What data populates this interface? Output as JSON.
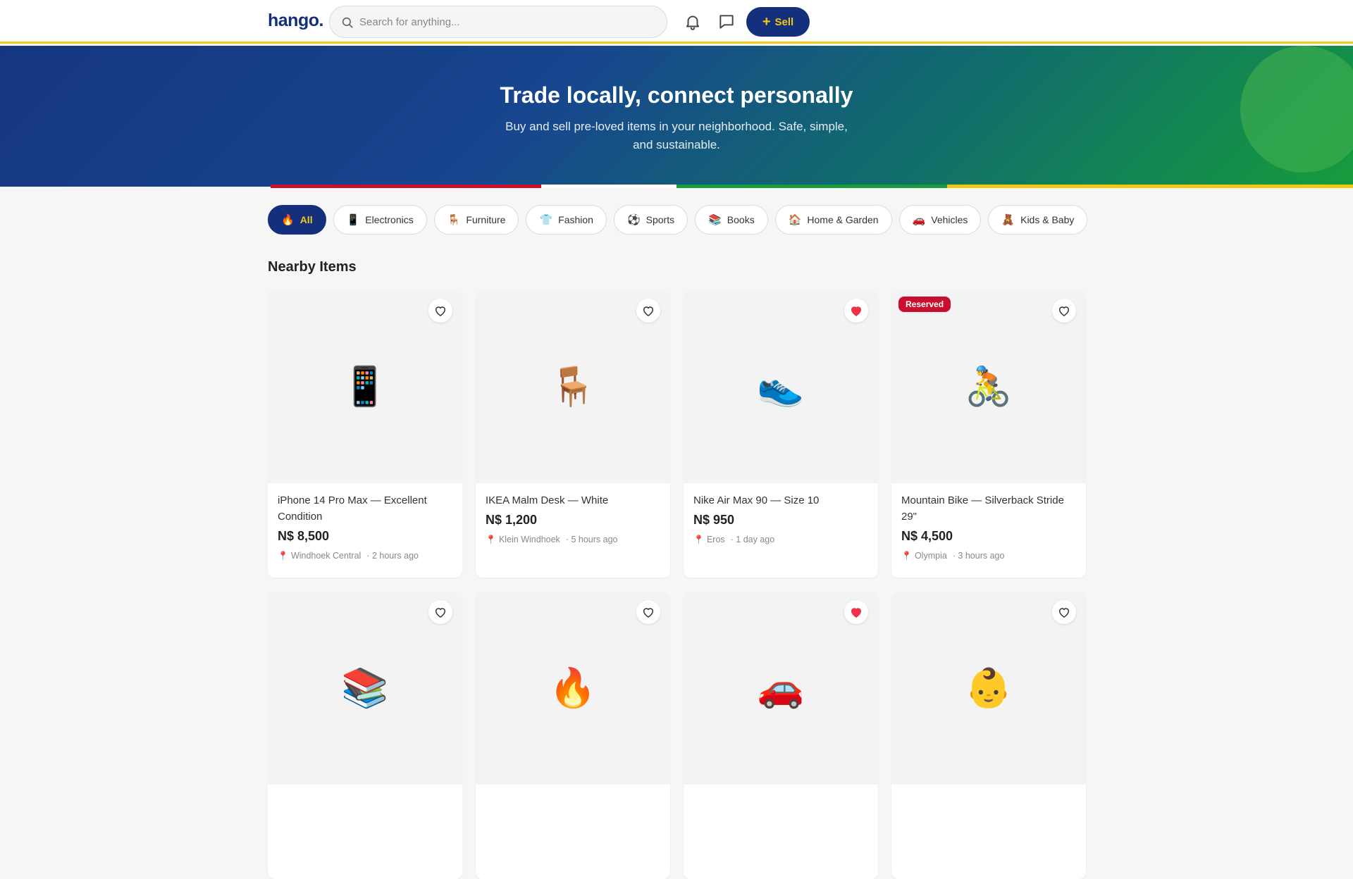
{
  "header": {
    "logo": "hango.",
    "search_placeholder": "Search for anything...",
    "sell_label": "Sell"
  },
  "hero": {
    "title": "Trade locally, connect personally",
    "subtitle": "Buy and sell pre-loved items in your neighborhood. Safe, simple, and sustainable."
  },
  "categories": [
    {
      "icon": "🔥",
      "label": "All",
      "active": true
    },
    {
      "icon": "📱",
      "label": "Electronics"
    },
    {
      "icon": "🪑",
      "label": "Furniture"
    },
    {
      "icon": "👕",
      "label": "Fashion"
    },
    {
      "icon": "⚽",
      "label": "Sports"
    },
    {
      "icon": "📚",
      "label": "Books"
    },
    {
      "icon": "🏠",
      "label": "Home & Garden"
    },
    {
      "icon": "🚗",
      "label": "Vehicles"
    },
    {
      "icon": "🧸",
      "label": "Kids & Baby"
    }
  ],
  "section_title": "Nearby Items",
  "items": [
    {
      "image": "📱",
      "title": "iPhone 14 Pro Max — Excellent Condition",
      "price": "N$ 8,500",
      "location": "Windhoek Central",
      "time": "· 2 hours ago",
      "favorited": false,
      "badge": ""
    },
    {
      "image": "🪑",
      "title": "IKEA Malm Desk — White",
      "price": "N$ 1,200",
      "location": "Klein Windhoek",
      "time": "· 5 hours ago",
      "favorited": false,
      "badge": ""
    },
    {
      "image": "👟",
      "title": "Nike Air Max 90 — Size 10",
      "price": "N$ 950",
      "location": "Eros",
      "time": "· 1 day ago",
      "favorited": true,
      "badge": ""
    },
    {
      "image": "🚴",
      "title": "Mountain Bike — Silverback Stride 29\"",
      "price": "N$ 4,500",
      "location": "Olympia",
      "time": "· 3 hours ago",
      "favorited": false,
      "badge": "Reserved"
    },
    {
      "image": "📚",
      "title": "",
      "price": "",
      "location": "",
      "time": "",
      "favorited": false,
      "badge": ""
    },
    {
      "image": "🔥",
      "title": "",
      "price": "",
      "location": "",
      "time": "",
      "favorited": false,
      "badge": ""
    },
    {
      "image": "🚗",
      "title": "",
      "price": "",
      "location": "",
      "time": "",
      "favorited": true,
      "badge": ""
    },
    {
      "image": "👶",
      "title": "",
      "price": "",
      "location": "",
      "time": "",
      "favorited": false,
      "badge": ""
    }
  ],
  "colors": {
    "brand_blue": "#14307c",
    "brand_yellow": "#f2c811",
    "brand_red": "#c8102e",
    "brand_green": "#169c3c",
    "heart_active": "#f0314a"
  }
}
